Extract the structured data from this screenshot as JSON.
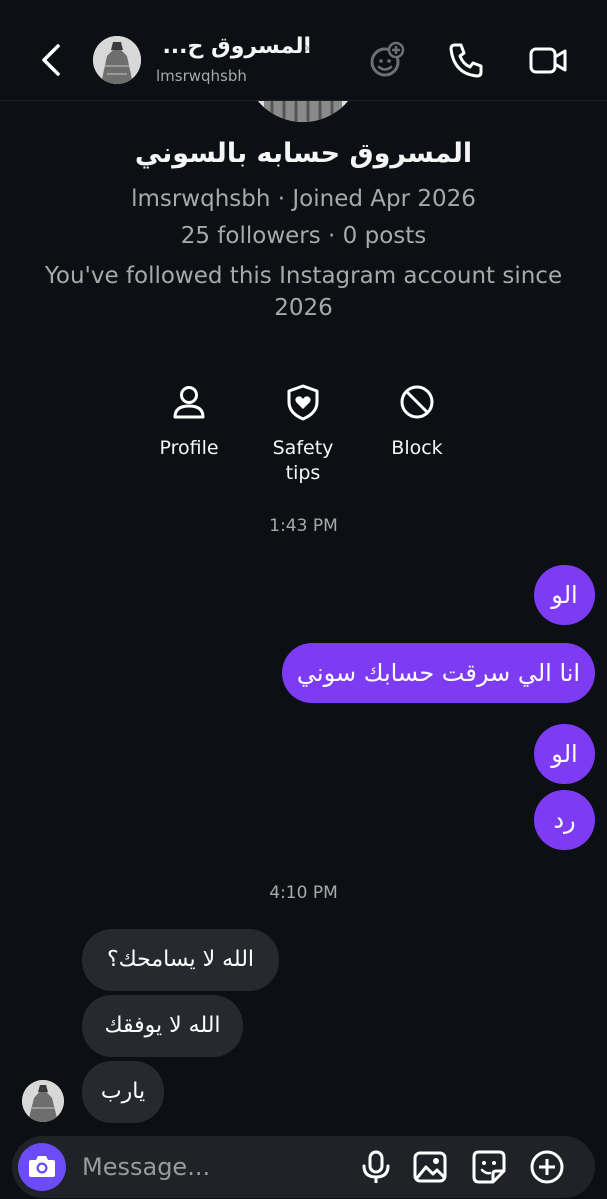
{
  "header": {
    "name": "المسروق ح...",
    "username": "lmsrwqhsbh"
  },
  "profile": {
    "display_name": "المسروق حسابه بالسوني",
    "meta_line": "lmsrwqhsbh · Joined Apr 2026",
    "stats_line": "25 followers · 0 posts",
    "follow_since": "You've followed this Instagram account since 2026"
  },
  "actions": [
    {
      "label": "Profile",
      "icon": "person-icon"
    },
    {
      "label": "Safety tips",
      "icon": "shield-heart-icon"
    },
    {
      "label": "Block",
      "icon": "block-icon"
    }
  ],
  "timestamps": [
    "1:43 PM",
    "4:10 PM"
  ],
  "sent_messages": [
    "الو",
    "انا الي سرقت حسابك سوني",
    "الو",
    "رد"
  ],
  "received_messages": [
    "الله لا يسامحك؟",
    "الله لا يوفقك",
    "يارب"
  ],
  "composer": {
    "placeholder": "Message..."
  },
  "colors": {
    "background": "#0c1014",
    "sent_bubble": "#7d3cf4",
    "received_bubble": "#262a30",
    "camera_button": "#6b4cf6"
  }
}
